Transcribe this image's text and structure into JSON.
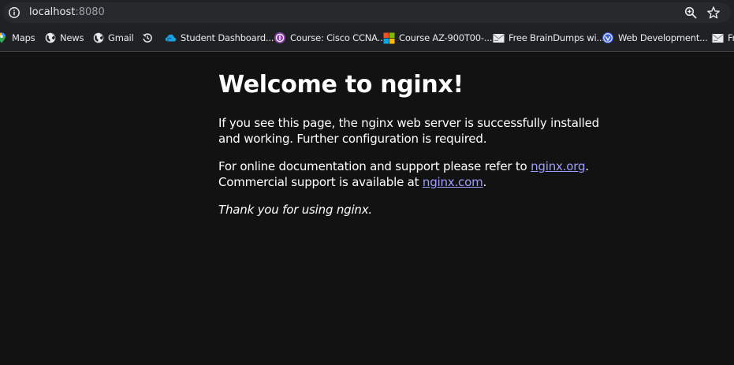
{
  "browser": {
    "url_host": "localhost",
    "url_port": ":8080",
    "icons": {
      "info": "info-circle-icon",
      "zoom": "zoom-in-icon",
      "bookmark_star": "star-outline-icon"
    }
  },
  "bookmarks": [
    {
      "label": "Maps",
      "icon": "maps-pin-icon"
    },
    {
      "label": "News",
      "icon": "globe-icon"
    },
    {
      "label": "Gmail",
      "icon": "globe-icon"
    },
    {
      "label": "",
      "icon": "history-icon"
    },
    {
      "label": "Student Dashboard...",
      "icon": "cloud-icon"
    },
    {
      "label": "Course: Cisco CCNA...",
      "icon": "course-badge-icon"
    },
    {
      "label": "Course AZ-900T00-...",
      "icon": "microsoft-logo-icon"
    },
    {
      "label": "Free BrainDumps wi...",
      "icon": "mail-icon"
    },
    {
      "label": "Web Development...",
      "icon": "shield-logo-icon"
    },
    {
      "label": "Fr",
      "icon": "mail-icon"
    }
  ],
  "page": {
    "title": "Welcome to nginx!",
    "p1": "If you see this page, the nginx web server is successfully installed and working. Further configuration is required.",
    "p2_a": "For online documentation and support please refer to ",
    "p2_link1": "nginx.org",
    "p2_b": ".",
    "p2_c": "Commercial support is available at ",
    "p2_link2": "nginx.com",
    "p2_d": ".",
    "p3": "Thank you for using nginx."
  },
  "colors": {
    "page_background": "#121212",
    "toolbar_background": "#202124",
    "link": "#9e9eff",
    "text": "#ffffff"
  }
}
